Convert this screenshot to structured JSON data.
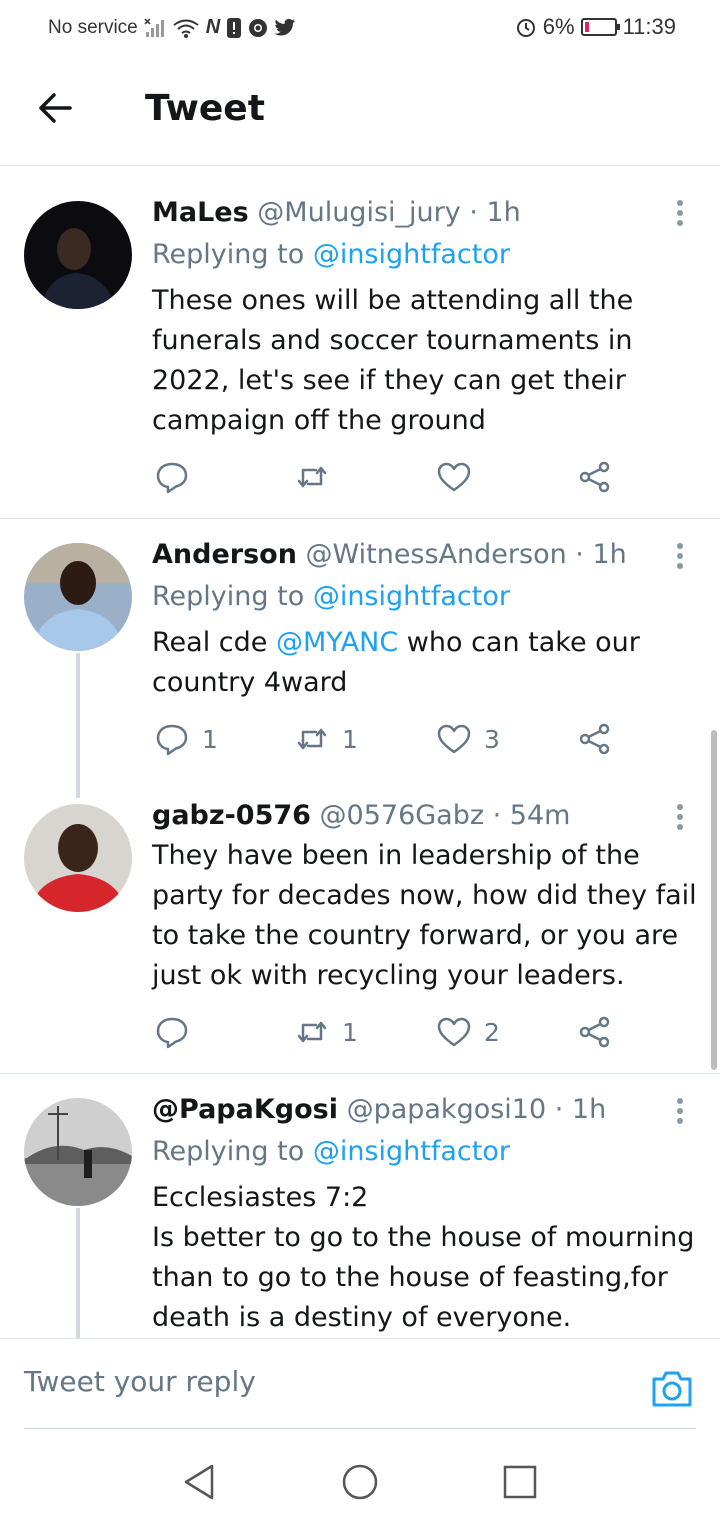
{
  "status_bar": {
    "carrier": "No service",
    "battery_pct": "6%",
    "time": "11:39",
    "icons": [
      "signal-off-icon",
      "wifi-icon",
      "nfc-icon",
      "alert-icon",
      "chrome-icon",
      "twitter-icon",
      "alarm-icon",
      "battery-icon"
    ]
  },
  "header": {
    "title": "Tweet",
    "back_icon": "back-arrow-icon"
  },
  "tweets": [
    {
      "name": "MaLes",
      "handle": "@Mulugisi_jury",
      "time": "· 1h",
      "replying_label": "Replying to ",
      "replying_to": "@insightfactor",
      "body": "These ones will be attending all the funerals and soccer tournaments in 2022, let's see if they can get their campaign off the ground",
      "replies": "",
      "retweets": "",
      "likes": ""
    },
    {
      "name": "Anderson",
      "handle": "@WitnessAnderson",
      "time": "· 1h",
      "replying_label": "Replying to ",
      "replying_to": "@insightfactor",
      "body_pre": "Real cde ",
      "body_mention": "@MYANC",
      "body_post": " who can take our country 4ward",
      "replies": "1",
      "retweets": "1",
      "likes": "3"
    },
    {
      "name": "gabz-0576",
      "handle": "@0576Gabz",
      "time": "· 54m",
      "body": "They have been in leadership of the party for decades now, how did they fail to take the country forward, or you are just ok with recycling your leaders.",
      "replies": "",
      "retweets": "1",
      "likes": "2"
    },
    {
      "name": "@PapaKgosi",
      "handle": "@papakgosi10",
      "time": "· 1h",
      "replying_label": "Replying to ",
      "replying_to": "@insightfactor",
      "body_line1": "Ecclesiastes 7:2",
      "body_line2": "Is better to go to the house of mourning than to go to the house of feasting,for death is a destiny of everyone."
    }
  ],
  "reply_bar": {
    "placeholder": "Tweet your reply",
    "camera_icon": "camera-icon"
  },
  "nav_bar": {
    "icons": [
      "nav-back-icon",
      "nav-home-icon",
      "nav-recents-icon"
    ]
  },
  "colors": {
    "accent": "#1da1f2",
    "text": "#14171a",
    "muted": "#657786",
    "divider": "#e1e8ed"
  }
}
